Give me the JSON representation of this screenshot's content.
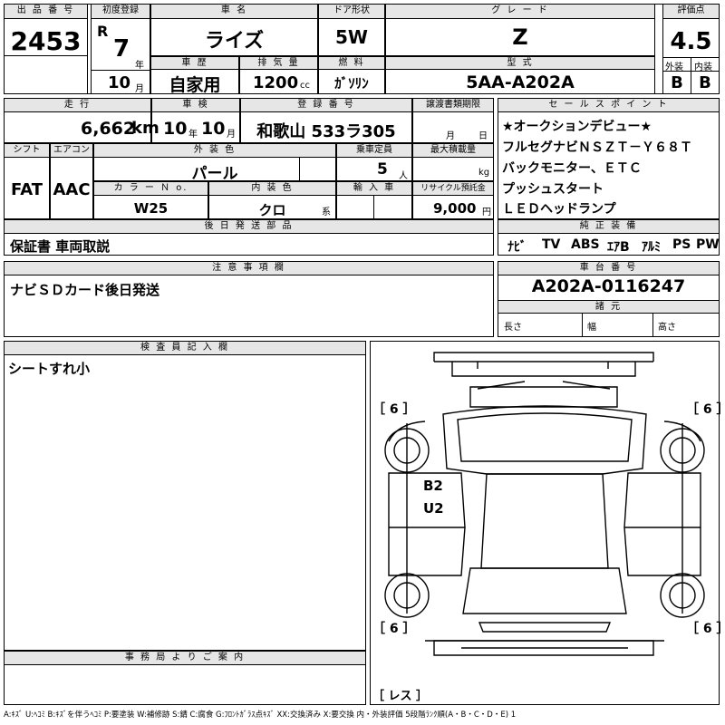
{
  "lot": {
    "label": "出 品 番 号",
    "value": "2453"
  },
  "first_reg": {
    "label": "初度登録",
    "era": "R",
    "year": "7",
    "year_unit": "年",
    "month": "10",
    "month_unit": "月"
  },
  "car_name": {
    "label": "車 名",
    "value": "ライズ"
  },
  "door": {
    "label": "ドア形状",
    "value": "5W"
  },
  "grade": {
    "label": "グ レ ー ド",
    "value": "Z"
  },
  "score": {
    "label": "評価点",
    "value": "4.5",
    "ext_label": "外装",
    "int_label": "内装",
    "ext_value": "B",
    "int_value": "B"
  },
  "history": {
    "label": "車 歴",
    "value": "自家用"
  },
  "displacement": {
    "label": "排 気 量",
    "value": "1200",
    "unit": "cc"
  },
  "fuel": {
    "label": "燃 料",
    "value": "ｶﾞｿﾘﾝ"
  },
  "model": {
    "label": "型 式",
    "value": "5AA-A202A"
  },
  "mileage": {
    "label": "走 行",
    "value": "6,662",
    "unit": "km"
  },
  "inspection": {
    "label": "車 検",
    "year": "10",
    "year_unit": "年",
    "month": "10",
    "month_unit": "月"
  },
  "plate": {
    "label": "登 録 番 号",
    "value": "和歌山 533ラ305"
  },
  "transfer_doc": {
    "label": "譲渡書類期限",
    "month_unit": "月",
    "day_unit": "日"
  },
  "shift": {
    "label": "シフト",
    "value": "FAT"
  },
  "aircon": {
    "label": "エアコン",
    "value": "AAC"
  },
  "ext_color": {
    "label": "外 装 色",
    "value": "パール"
  },
  "capacity": {
    "label": "乗車定員",
    "value": "5",
    "unit": "人"
  },
  "max_load": {
    "label": "最大積載量",
    "unit": "kg"
  },
  "color_no": {
    "label": "カ ラ ー Ｎ o.",
    "value": "W25"
  },
  "int_color": {
    "label": "内 装 色",
    "value": "クロ",
    "unit": "系"
  },
  "import": {
    "label": "輸 入 車"
  },
  "recycle": {
    "label": "リサイクル預託金",
    "value": "9,000",
    "unit": "円"
  },
  "sales_points": {
    "label": "セ ー ル ス ポ イ ン ト",
    "lines": [
      "★オークションデビュー★",
      "フルセグナビＮＳＺＴ－Ｙ６８Ｔ",
      "バックモニター、ＥＴＣ",
      "プッシュスタート",
      "ＬＥＤヘッドランプ"
    ]
  },
  "later_items": {
    "label": "後 日 発 送 部 品",
    "value": "保証書 車両取説"
  },
  "equipment": {
    "label": "純 正 装 備",
    "items": [
      "ﾅﾋﾞ",
      "TV",
      "ABS",
      "ｴｱB",
      "ｱﾙﾐ",
      "PS",
      "PW"
    ]
  },
  "notes": {
    "label": "注 意 事 項 欄",
    "value": "ナビＳＤカード後日発送"
  },
  "chassis": {
    "label": "車 台 番 号",
    "value": "A202A-0116247"
  },
  "dims": {
    "label": "諸 元",
    "length": "長さ",
    "width": "幅",
    "height": "高さ"
  },
  "inspector": {
    "label": "検 査 員 記 入 欄",
    "value": "シートすれ小"
  },
  "office": {
    "label": "事 務 局 よ り ご 案 内"
  },
  "diagram": {
    "tl": "［ 6 ］",
    "tr": "［ 6 ］",
    "bl": "［ 6 ］",
    "br": "［ 6 ］",
    "mark1": "B2",
    "mark2": "U2",
    "bottom": "［ レス ］"
  },
  "legend": "A:ｷｽﾞ U:ﾍｺﾐ B:ｷｽﾞを伴うﾍｺﾐ P:要塗装 W:補修跡 S:錆 C:腐食 G:ﾌﾛﾝﾄｶﾞﾗｽ点ｷｽﾞ XX:交換済み X:要交換 内・外装評価 5段階ﾗﾝｸ順(A・B・C・D・E) 1"
}
